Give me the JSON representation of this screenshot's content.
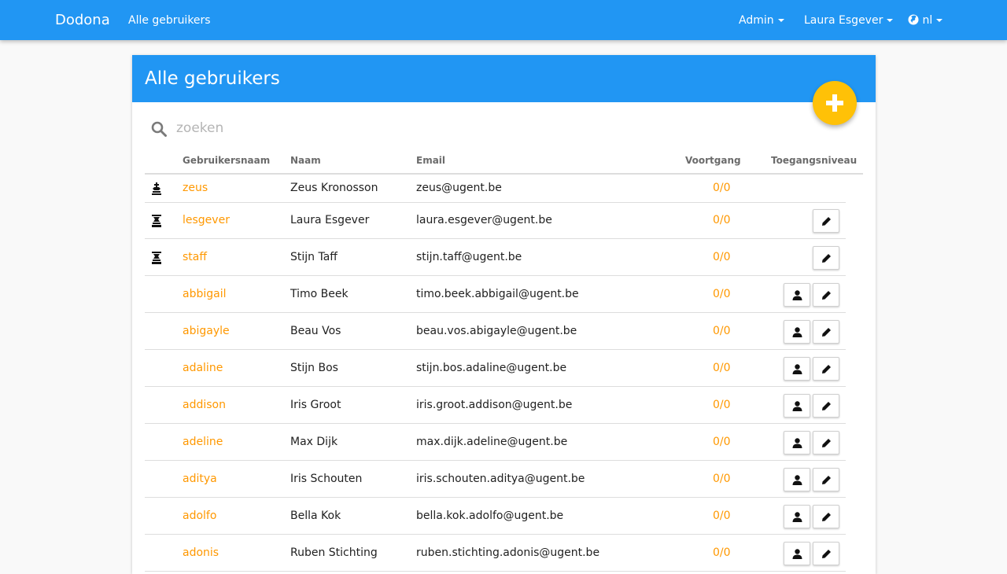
{
  "navbar": {
    "brand": "Dodona",
    "all_users_link": "Alle gebruikers",
    "admin_menu": "Admin",
    "user_menu": "Laura Esgever",
    "language_menu": "nl"
  },
  "card": {
    "title": "Alle gebruikers",
    "search_placeholder": "zoeken"
  },
  "table": {
    "headers": {
      "username": "Gebruikersnaam",
      "name": "Naam",
      "email": "Email",
      "progress": "Voortgang",
      "access": "Toegangsniveau"
    },
    "rows": [
      {
        "username": "zeus",
        "name": "Zeus Kronosson",
        "email": "zeus@ugent.be",
        "progress": "0/0",
        "role_icon": "king-icon"
      },
      {
        "username": "lesgever",
        "name": "Laura Esgever",
        "email": "laura.esgever@ugent.be",
        "progress": "0/0",
        "role_icon": "queen-icon"
      },
      {
        "username": "staff",
        "name": "Stijn Taff",
        "email": "stijn.taff@ugent.be",
        "progress": "0/0",
        "role_icon": "queen-icon"
      },
      {
        "username": "abbigail",
        "name": "Timo Beek",
        "email": "timo.beek.abbigail@ugent.be",
        "progress": "0/0"
      },
      {
        "username": "abigayle",
        "name": "Beau Vos",
        "email": "beau.vos.abigayle@ugent.be",
        "progress": "0/0"
      },
      {
        "username": "adaline",
        "name": "Stijn Bos",
        "email": "stijn.bos.adaline@ugent.be",
        "progress": "0/0"
      },
      {
        "username": "addison",
        "name": "Iris Groot",
        "email": "iris.groot.addison@ugent.be",
        "progress": "0/0"
      },
      {
        "username": "adeline",
        "name": "Max Dijk",
        "email": "max.dijk.adeline@ugent.be",
        "progress": "0/0"
      },
      {
        "username": "aditya",
        "name": "Iris Schouten",
        "email": "iris.schouten.aditya@ugent.be",
        "progress": "0/0"
      },
      {
        "username": "adolfo",
        "name": "Bella Kok",
        "email": "bella.kok.adolfo@ugent.be",
        "progress": "0/0"
      },
      {
        "username": "adonis",
        "name": "Ruben Stichting",
        "email": "ruben.stichting.adonis@ugent.be",
        "progress": "0/0"
      }
    ]
  },
  "colors": {
    "primary": "#2196f3",
    "accent": "#ff9800",
    "fab": "#ffc107"
  }
}
